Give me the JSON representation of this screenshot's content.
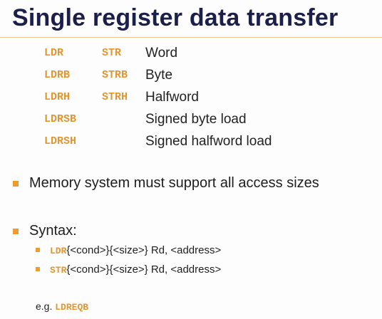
{
  "title": "Single register data transfer",
  "instructions": [
    {
      "load": "LDR",
      "store": "STR",
      "desc": "Word"
    },
    {
      "load": "LDRB",
      "store": "STRB",
      "desc": "Byte"
    },
    {
      "load": "LDRH",
      "store": "STRH",
      "desc": "Halfword"
    },
    {
      "load": "LDRSB",
      "store": "",
      "desc": "Signed byte load"
    },
    {
      "load": "LDRSH",
      "store": "",
      "desc": "Signed halfword load"
    }
  ],
  "bullets": {
    "memory": "Memory system must support all access sizes",
    "syntax": "Syntax:"
  },
  "syntax_lines": [
    {
      "op": "LDR",
      "rest": "{<cond>}{<size>} Rd, <address>"
    },
    {
      "op": "STR",
      "rest": "{<cond>}{<size>} Rd, <address>"
    }
  ],
  "example": {
    "prefix": "e.g. ",
    "op": "LDREQB"
  },
  "colors": {
    "title": "#1b1f4a",
    "accent": "#e3962f",
    "bullet": "#ef9b2f"
  }
}
